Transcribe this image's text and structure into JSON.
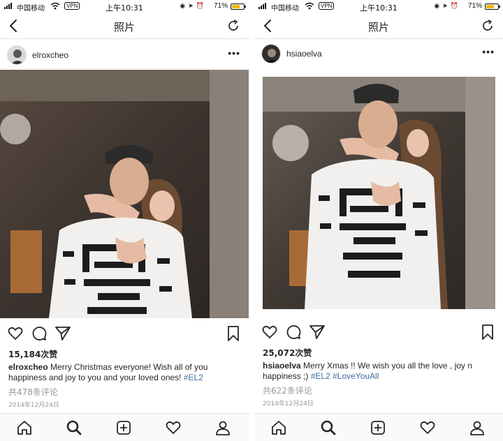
{
  "status_bar": {
    "carrier": "中国移动",
    "vpn": "VPN",
    "time": "上午10:31",
    "battery_percent": "71%",
    "battery_level": 0.71
  },
  "nav": {
    "title": "照片"
  },
  "posts": [
    {
      "username": "elroxcheo",
      "likes": "15,184次赞",
      "caption_user": "elroxcheo",
      "caption_text": "Merry Christmas everyone! Wish all of you happiness and joy to you and your loved ones!",
      "caption_tags": [
        "#EL2"
      ],
      "comments": "共478条评论",
      "date": "2014年12月24日"
    },
    {
      "username": "hsiaoelva",
      "likes": "25,072次赞",
      "caption_user": "hsiaoelva",
      "caption_text": "Merry Xmas !! We wish you all the love , joy n happiness ;)",
      "caption_tags": [
        "#EL2",
        "#LoveYouAll"
      ],
      "comments": "共622条评论",
      "date": "2014年12月24日"
    }
  ],
  "colors": {
    "hashtag": "#3f6ea3",
    "battery": "#f5b400",
    "muted_text": "#999999"
  },
  "icons": {
    "nav": [
      "back-arrow-icon",
      "refresh-icon"
    ],
    "actions": [
      "heart-icon",
      "comment-icon",
      "share-icon",
      "bookmark-icon"
    ],
    "tabs": [
      "home-icon",
      "search-icon",
      "add-post-icon",
      "activity-heart-icon",
      "profile-icon"
    ]
  }
}
